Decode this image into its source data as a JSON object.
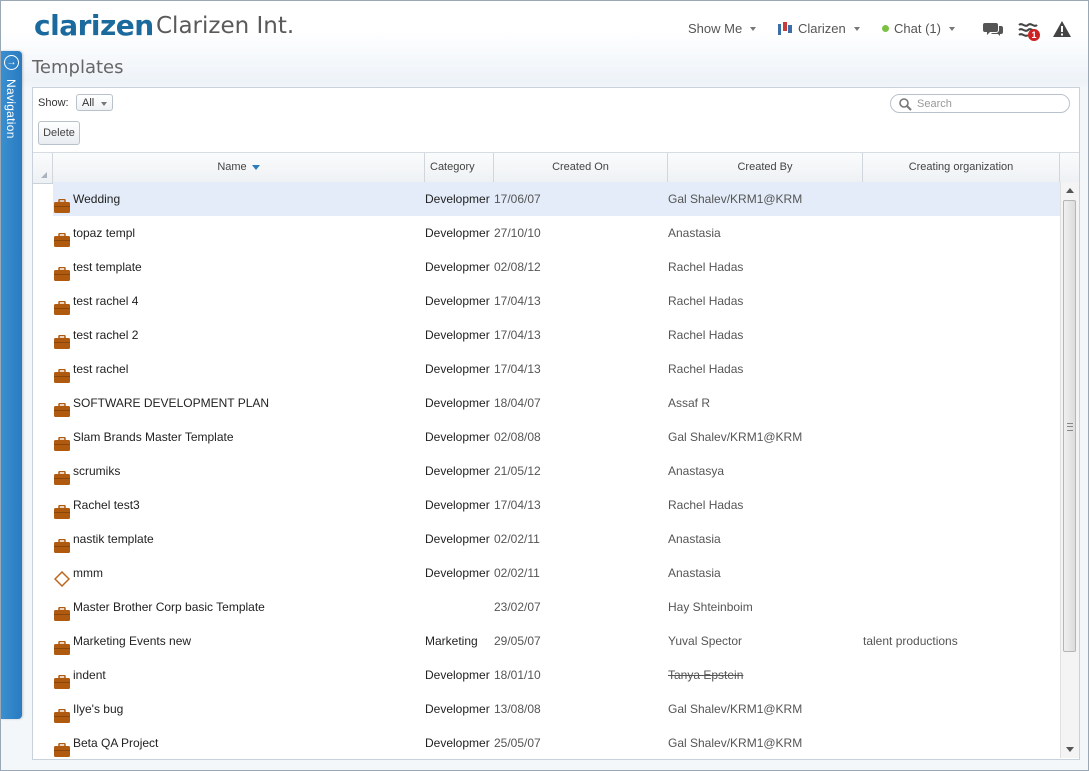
{
  "header": {
    "logo_text": "clarizen",
    "app_name": "Clarizen Int.",
    "show_me": "Show Me",
    "user_menu": "Clarizen",
    "chat": "Chat (1)",
    "notifications_badge": "1",
    "icons": [
      "chat-bubbles-icon",
      "stream-icon",
      "warning-icon"
    ]
  },
  "nav": {
    "label": "Navigation"
  },
  "page": {
    "title": "Templates"
  },
  "toolbar": {
    "show_label": "Show:",
    "show_value": "All",
    "delete_label": "Delete",
    "search_placeholder": "Search"
  },
  "table": {
    "columns": [
      "Name",
      "Category",
      "Created On",
      "Created By",
      "Creating organization"
    ],
    "sorted_column": "Name",
    "rows": [
      {
        "name": "Wedding",
        "icon": "briefcase",
        "category": "Developmer",
        "created_on": "17/06/07",
        "created_by": "Gal Shalev/KRM1@KRM",
        "org": "",
        "selected": true
      },
      {
        "name": "topaz templ",
        "icon": "briefcase",
        "category": "Developmer",
        "created_on": "27/10/10",
        "created_by": "Anastasia",
        "org": ""
      },
      {
        "name": "test template",
        "icon": "briefcase",
        "category": "Developmer",
        "created_on": "02/08/12",
        "created_by": "Rachel Hadas",
        "org": ""
      },
      {
        "name": "test rachel 4",
        "icon": "briefcase",
        "category": "Developmer",
        "created_on": "17/04/13",
        "created_by": "Rachel Hadas",
        "org": ""
      },
      {
        "name": "test rachel 2",
        "icon": "briefcase",
        "category": "Developmer",
        "created_on": "17/04/13",
        "created_by": "Rachel Hadas",
        "org": ""
      },
      {
        "name": "test rachel",
        "icon": "briefcase",
        "category": "Developmer",
        "created_on": "17/04/13",
        "created_by": "Rachel Hadas",
        "org": ""
      },
      {
        "name": "SOFTWARE DEVELOPMENT PLAN",
        "icon": "briefcase",
        "category": "Developmer",
        "created_on": "18/04/07",
        "created_by": "Assaf R",
        "org": ""
      },
      {
        "name": "Slam Brands Master Template",
        "icon": "briefcase",
        "category": "Developmer",
        "created_on": "02/08/08",
        "created_by": "Gal Shalev/KRM1@KRM",
        "org": ""
      },
      {
        "name": "scrumiks",
        "icon": "briefcase",
        "category": "Developmer",
        "created_on": "21/05/12",
        "created_by": "Anastasya",
        "org": ""
      },
      {
        "name": "Rachel test3",
        "icon": "briefcase",
        "category": "Developmer",
        "created_on": "17/04/13",
        "created_by": "Rachel Hadas",
        "org": ""
      },
      {
        "name": "nastik template",
        "icon": "briefcase",
        "category": "Developmer",
        "created_on": "02/02/11",
        "created_by": "Anastasia",
        "org": ""
      },
      {
        "name": "mmm",
        "icon": "diamond",
        "category": "Developmer",
        "created_on": "02/02/11",
        "created_by": "Anastasia",
        "org": ""
      },
      {
        "name": "Master Brother Corp basic Template",
        "icon": "briefcase",
        "category": "",
        "created_on": "23/02/07",
        "created_by": "Hay Shteinboim",
        "org": ""
      },
      {
        "name": "Marketing Events new",
        "icon": "briefcase",
        "category": "Marketing",
        "created_on": "29/05/07",
        "created_by": "Yuval Spector",
        "org": "talent productions"
      },
      {
        "name": "indent",
        "icon": "briefcase",
        "category": "Developmer",
        "created_on": "18/01/10",
        "created_by": "Tanya Epstein",
        "org": "",
        "created_by_strike": true
      },
      {
        "name": "Ilye's bug",
        "icon": "briefcase",
        "category": "Developmer",
        "created_on": "13/08/08",
        "created_by": "Gal Shalev/KRM1@KRM",
        "org": ""
      },
      {
        "name": "Beta QA Project",
        "icon": "briefcase",
        "category": "Developmer",
        "created_on": "25/05/07",
        "created_by": "Gal Shalev/KRM1@KRM",
        "org": ""
      }
    ]
  },
  "colors": {
    "brand": "#1a6a9e",
    "nav_tab": "#2a7bc0",
    "briefcase": "#b05a10",
    "selected_row": "#e3ecf8",
    "online": "#7cc242",
    "badge": "#cc2222"
  }
}
